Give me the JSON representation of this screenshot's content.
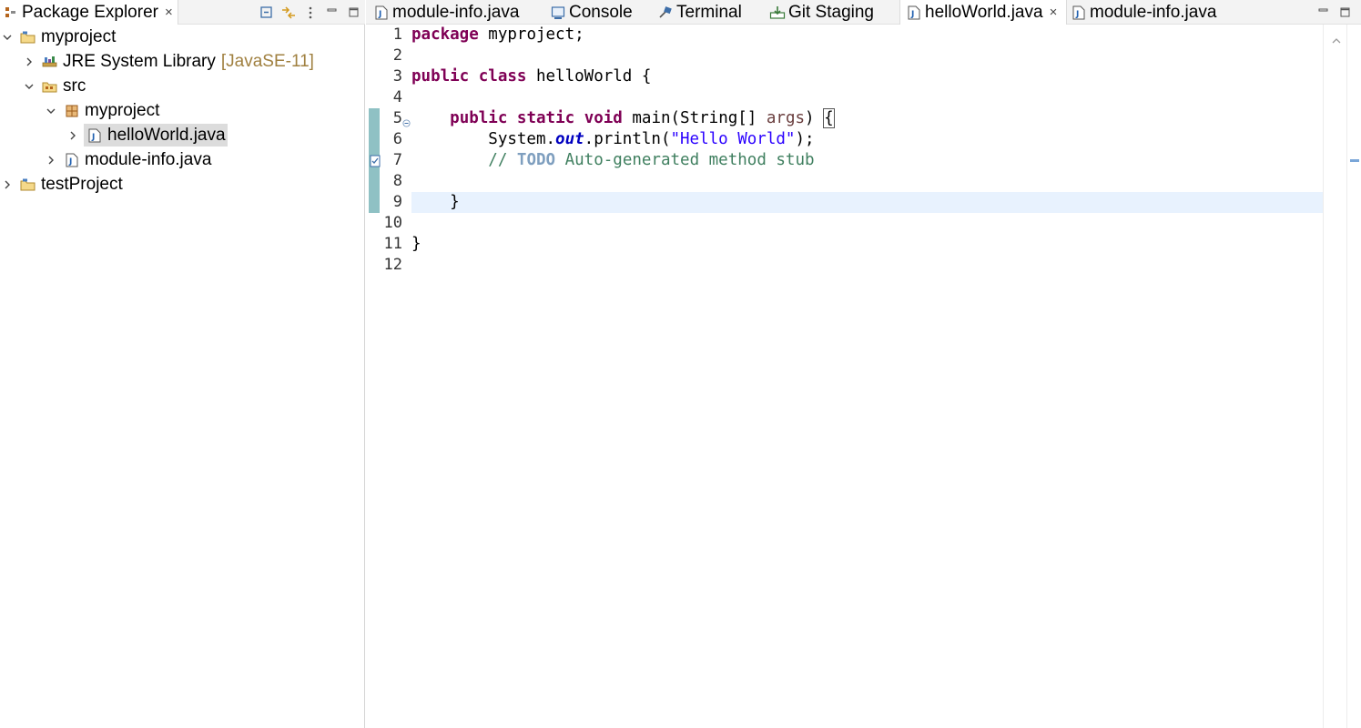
{
  "explorer": {
    "title": "Package Explorer",
    "close": "×",
    "tree": [
      {
        "label": "myproject",
        "decoration": "",
        "expanded": true,
        "icon": "project-icon"
      },
      {
        "label": "JRE System Library",
        "decoration": "[JavaSE-11]",
        "expanded": false,
        "icon": "library-icon"
      },
      {
        "label": "src",
        "decoration": "",
        "expanded": true,
        "icon": "source-folder-icon"
      },
      {
        "label": "myproject",
        "decoration": "",
        "expanded": true,
        "icon": "package-icon"
      },
      {
        "label": "helloWorld.java",
        "decoration": "",
        "expanded": false,
        "icon": "java-file-icon",
        "selected": true
      },
      {
        "label": "module-info.java",
        "decoration": "",
        "expanded": false,
        "icon": "java-file-icon"
      },
      {
        "label": "testProject",
        "decoration": "",
        "expanded": false,
        "icon": "project-icon"
      }
    ]
  },
  "editor": {
    "tabs": [
      {
        "label": "module-info.java",
        "icon": "java-file-icon"
      },
      {
        "label": "Console",
        "icon": "console-icon"
      },
      {
        "label": "Terminal",
        "icon": "terminal-icon"
      },
      {
        "label": "Git Staging",
        "icon": "git-staging-icon"
      },
      {
        "label": "helloWorld.java",
        "icon": "java-file-icon",
        "active": true,
        "close": "×"
      },
      {
        "label": "module-info.java",
        "icon": "java-file-icon"
      }
    ],
    "line_numbers": [
      "1",
      "2",
      "3",
      "4",
      "5",
      "6",
      "7",
      "8",
      "9",
      "10",
      "11",
      "12"
    ],
    "code": {
      "l1_kw": "package",
      "l1_rest": " myproject;",
      "l3_kw1": "public",
      "l3_kw2": "class",
      "l3_rest": " helloWorld {",
      "l5_indent": "    ",
      "l5_kw1": "public",
      "l5_kw2": "static",
      "l5_kw3": "void",
      "l5_mid": " main(String[] ",
      "l5_param": "args",
      "l5_close": ") ",
      "l5_brace": "{",
      "l6_pre": "        System.",
      "l6_field": "out",
      "l6_mid": ".println(",
      "l6_str": "\"Hello World\"",
      "l6_end": ");",
      "l7_pre": "        // ",
      "l7_todo": "TODO",
      "l7_rest": " Auto-generated method stub",
      "l9": "    }",
      "l11": "}"
    }
  },
  "colors": {
    "keyword": "#7f0055",
    "string": "#2a00ff",
    "comment": "#3f7f5f",
    "todo": "#7f9fbf",
    "current_line": "#e8f2fe",
    "change_bar": "#8fc1c4"
  }
}
